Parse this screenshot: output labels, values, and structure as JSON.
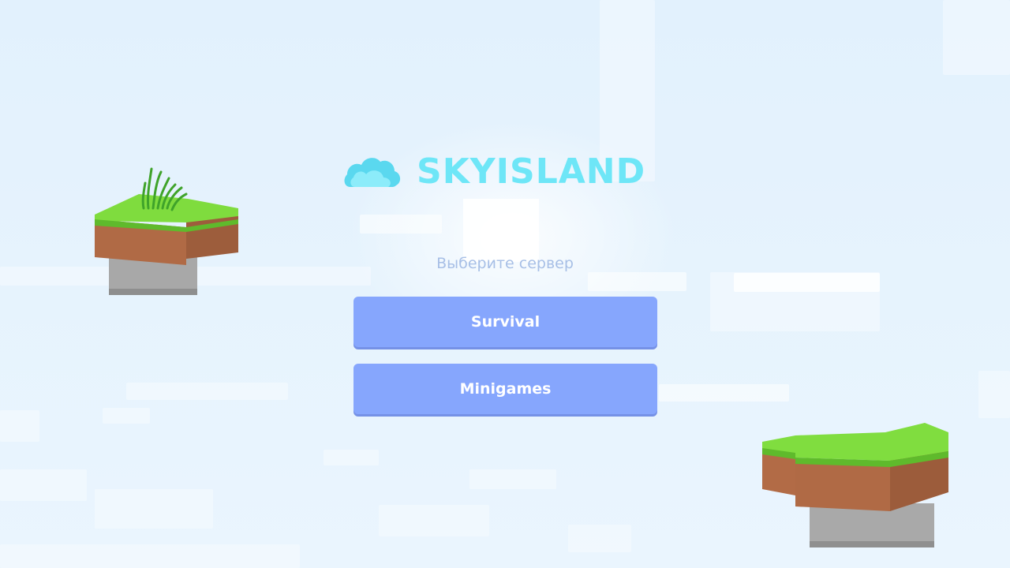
{
  "app": {
    "logo_text": "SKYISLAND",
    "logo_icon": "cloud-icon"
  },
  "menu": {
    "subtitle": "Выберите сервер",
    "buttons": [
      {
        "label": "Survival"
      },
      {
        "label": "Minigames"
      }
    ]
  },
  "colors": {
    "background": "#e4f2fd",
    "button": "#86a6fd",
    "button_text": "#ffffff",
    "logo": "#6ee6f7",
    "subtitle": "#a7bfe6",
    "grass": "#7dde3f",
    "dirt": "#b5704a",
    "stone": "#a9a9a9"
  }
}
